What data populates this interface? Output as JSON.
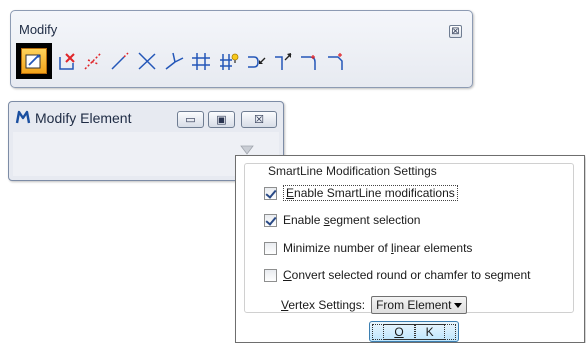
{
  "modify_toolbox": {
    "title": "Modify",
    "close_glyph": "⊠",
    "tools": [
      {
        "name": "modify-element-tool-icon",
        "active": true
      },
      {
        "name": "delete-part-of-element-icon"
      },
      {
        "name": "extend-line-icon"
      },
      {
        "name": "extend-elements-to-intersection-icon"
      },
      {
        "name": "extend-element-to-intersection-icon"
      },
      {
        "name": "trim-to-element-icon"
      },
      {
        "name": "trim-multiple-icon"
      },
      {
        "name": "intellitrim-icon"
      },
      {
        "name": "insert-vertex-icon"
      },
      {
        "name": "delete-vertex-icon"
      },
      {
        "name": "construct-circular-fillet-icon"
      },
      {
        "name": "construct-chamfer-icon"
      }
    ]
  },
  "modify_element": {
    "title": "Modify Element",
    "minimize_glyph": "▭",
    "restore_glyph": "▣",
    "close_glyph": "☒"
  },
  "settings": {
    "group_label": "SmartLine Modification Settings",
    "options": [
      {
        "pre": "",
        "accel": "E",
        "post": "nable SmartLine modifications",
        "checked": true
      },
      {
        "pre": "Enable ",
        "accel": "s",
        "post": "egment selection",
        "checked": true
      },
      {
        "pre": "Minimize number of ",
        "accel": "l",
        "post": "inear elements",
        "checked": false
      },
      {
        "pre": "",
        "accel": "C",
        "post": "onvert selected round or chamfer to segment",
        "checked": false
      }
    ],
    "vertex": {
      "pre": "",
      "accel": "V",
      "post": "ertex Settings:",
      "value": "From Element"
    },
    "ok": {
      "accel": "O",
      "post": "K"
    }
  },
  "colors": {
    "accent_orange": "#f3a31a",
    "accent_red": "#e0262a",
    "line_blue": "#2457b8"
  }
}
